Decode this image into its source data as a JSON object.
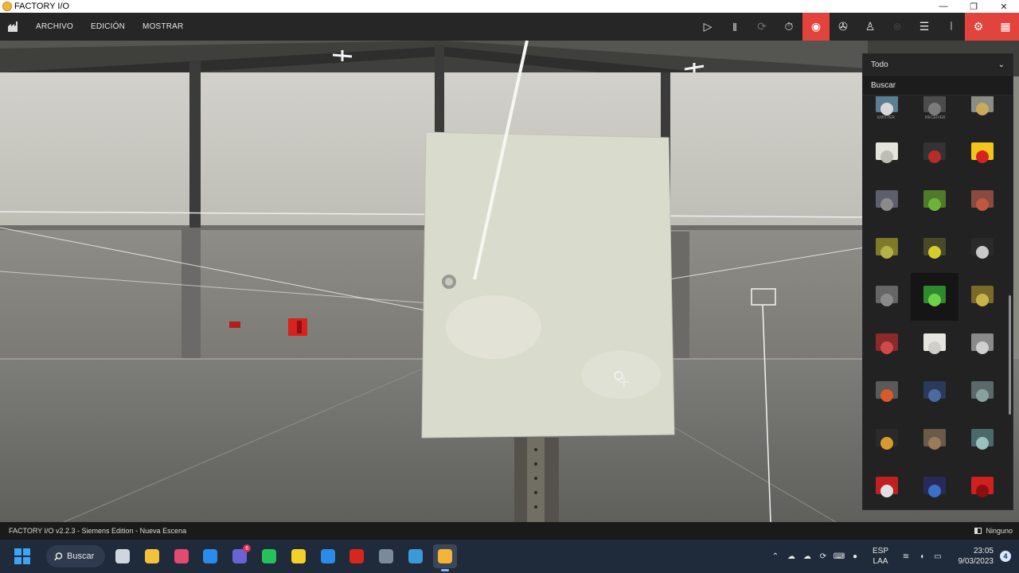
{
  "window": {
    "title": "FACTORY I/O",
    "controls": {
      "minimize": "—",
      "restore": "❐",
      "close": "✕"
    }
  },
  "menubar": {
    "items": [
      "ARCHIVO",
      "EDICIÓN",
      "MOSTRAR"
    ]
  },
  "toolbar": {
    "buttons": [
      {
        "name": "play-icon",
        "glyph": "▷",
        "state": "normal"
      },
      {
        "name": "pause-icon",
        "glyph": "‖",
        "state": "normal"
      },
      {
        "name": "reset-icon",
        "glyph": "⟳",
        "state": "dim"
      },
      {
        "name": "stopwatch-icon",
        "glyph": "⏱",
        "state": "normal"
      },
      {
        "name": "driver-icon",
        "glyph": "◉",
        "state": "active"
      },
      {
        "name": "camera-orbit-icon",
        "glyph": "✇",
        "state": "normal"
      },
      {
        "name": "walk-icon",
        "glyph": "♙",
        "state": "normal"
      },
      {
        "name": "settings-icon",
        "glyph": "⌾",
        "state": "dim"
      },
      {
        "name": "list-icon",
        "glyph": "☰",
        "state": "normal"
      },
      {
        "name": "sensor-icon",
        "glyph": "⦚",
        "state": "normal"
      },
      {
        "name": "parts-icon",
        "glyph": "⚙",
        "state": "active"
      },
      {
        "name": "grid-icon",
        "glyph": "▦",
        "state": "active"
      }
    ]
  },
  "panel": {
    "filter_label": "Todo",
    "filter_chevron": "⌄",
    "search_label": "Buscar",
    "top_labels": [
      "EMITTER",
      "RECEIVER"
    ],
    "item_count": 30,
    "selected_index": 13
  },
  "statusbar": {
    "left_text": "FACTORY I/O v2.2.3 - Siemens Edition - Nueva Escena",
    "right_text": "Ninguno"
  },
  "taskbar": {
    "search_label": "Buscar",
    "apps": [
      "task-view-icon",
      "file-explorer-icon",
      "snipping-tool-icon",
      "edge-icon",
      "teams-icon",
      "whatsapp-icon",
      "sticky-notes-icon",
      "mail-icon",
      "acrobat-icon",
      "settings-icon",
      "remote-desktop-icon",
      "factory-io-icon"
    ],
    "teams_badge": "6",
    "tray": {
      "lang_top": "ESP",
      "lang_bottom": "LAA",
      "time": "23:05",
      "date": "9/03/2023",
      "notifications": "4"
    }
  },
  "colors": {
    "accent": "#e0443d",
    "menubar_bg": "#262626",
    "taskbar_bg": "#1f2a3a"
  }
}
